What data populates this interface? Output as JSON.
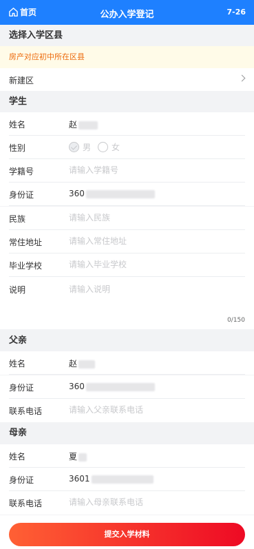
{
  "navbar": {
    "home_label": "首页",
    "title": "公办入学登记",
    "right_text": "7-26"
  },
  "district": {
    "section_title": "选择入学区县",
    "notice": "房产对应初中所在区县",
    "selected": "新建区"
  },
  "student": {
    "section_title": "学生",
    "name_label": "姓名",
    "name_value": "赵",
    "gender_label": "性别",
    "gender_male": "男",
    "gender_female": "女",
    "roll_label": "学籍号",
    "roll_placeholder": "请输入学籍号",
    "id_label": "身份证",
    "id_value": "360",
    "ethnicity_label": "民族",
    "ethnicity_placeholder": "请输入民族",
    "address_label": "常住地址",
    "address_placeholder": "请输入常住地址",
    "school_label": "毕业学校",
    "school_placeholder": "请输入毕业学校",
    "note_label": "说明",
    "note_placeholder": "请输入说明",
    "note_counter": "0/150"
  },
  "father": {
    "section_title": "父亲",
    "name_label": "姓名",
    "name_value": "赵",
    "id_label": "身份证",
    "id_value": "360",
    "phone_label": "联系电话",
    "phone_placeholder": "请输入父亲联系电话"
  },
  "mother": {
    "section_title": "母亲",
    "name_label": "姓名",
    "name_value": "夏",
    "id_label": "身份证",
    "id_value": "3601",
    "phone_label": "联系电话",
    "phone_placeholder": "请输入母亲联系电话"
  },
  "footer": {
    "submit_label": "提交入学材料"
  },
  "colors": {
    "primary": "#1e80ff",
    "notice_bg": "#fffbe8",
    "notice_text": "#ed6a0c",
    "submit_start": "#ff6034",
    "submit_end": "#ee0a24"
  },
  "icons": {
    "home": "home-icon",
    "chevron": "chevron-right-icon",
    "check": "check-icon"
  }
}
